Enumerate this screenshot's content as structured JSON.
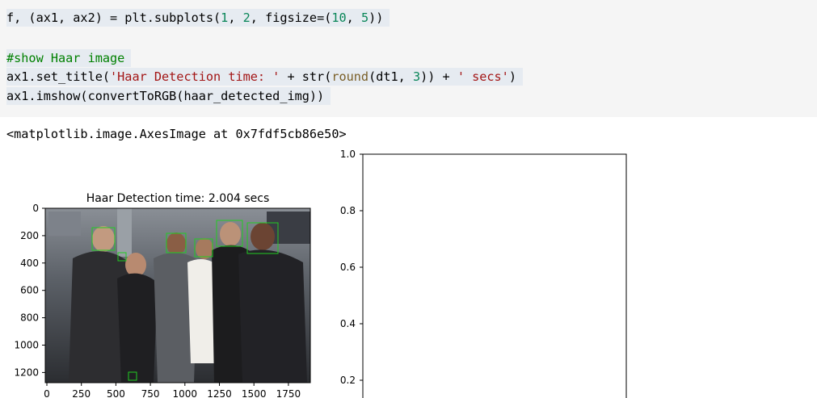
{
  "code_cell": {
    "lines": [
      {
        "selected": true,
        "tokens": [
          {
            "t": "f, (ax1, ax2) = plt.subplots(",
            "c": "txt"
          },
          {
            "t": "1",
            "c": "num"
          },
          {
            "t": ", ",
            "c": "txt"
          },
          {
            "t": "2",
            "c": "num"
          },
          {
            "t": ", figsize=(",
            "c": "txt"
          },
          {
            "t": "10",
            "c": "num"
          },
          {
            "t": ", ",
            "c": "txt"
          },
          {
            "t": "5",
            "c": "num"
          },
          {
            "t": "))",
            "c": "txt"
          }
        ]
      },
      {
        "selected": false,
        "tokens": []
      },
      {
        "selected": true,
        "tokens": [
          {
            "t": "#show Haar image",
            "c": "com"
          }
        ]
      },
      {
        "selected": true,
        "tokens": [
          {
            "t": "ax1.set_title(",
            "c": "txt"
          },
          {
            "t": "'Haar Detection time: '",
            "c": "str"
          },
          {
            "t": " + str(",
            "c": "txt"
          },
          {
            "t": "round",
            "c": "fn"
          },
          {
            "t": "(dt1, ",
            "c": "txt"
          },
          {
            "t": "3",
            "c": "num"
          },
          {
            "t": ")) + ",
            "c": "txt"
          },
          {
            "t": "' secs'",
            "c": "str"
          },
          {
            "t": ")",
            "c": "txt"
          }
        ]
      },
      {
        "selected": true,
        "tokens": [
          {
            "t": "ax1.imshow(convertToRGB(haar_detected_img))",
            "c": "txt"
          }
        ]
      }
    ]
  },
  "output": {
    "text": "<matplotlib.image.AxesImage at 0x7fdf5cb86e50>"
  },
  "figure": {
    "ax1": {
      "title": "Haar Detection time: 2.004 secs",
      "yticks": [
        "0",
        "200",
        "400",
        "600",
        "800",
        "1000",
        "1200"
      ],
      "xticks": [
        "0",
        "250",
        "500",
        "750",
        "1000",
        "1250",
        "1500",
        "1750"
      ]
    },
    "ax2": {
      "yticks": [
        "1.0",
        "0.8",
        "0.6",
        "0.4",
        "0.2"
      ]
    }
  },
  "colors": {
    "code_bg": "#f5f5f5",
    "selection_bg": "#e6ebf1",
    "number": "#098658",
    "string": "#a31515",
    "comment": "#008000",
    "function": "#795e26",
    "detection_box": "#22cc22"
  }
}
